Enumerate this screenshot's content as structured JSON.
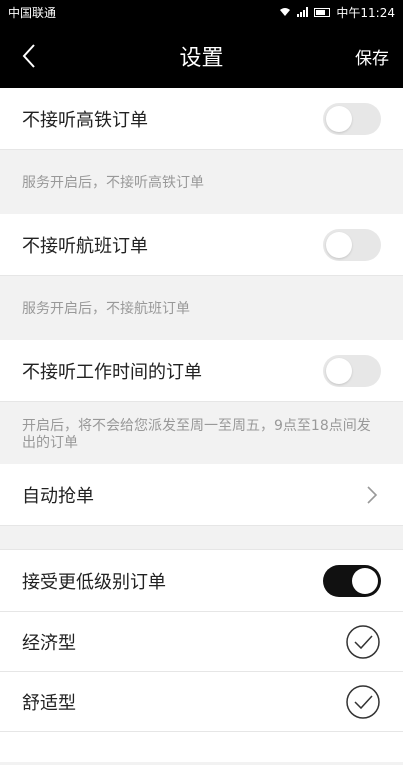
{
  "statusbar": {
    "carrier": "中国联通",
    "time": "中午11:24"
  },
  "navbar": {
    "title": "设置",
    "save": "保存"
  },
  "settings": {
    "high_speed_rail": {
      "label": "不接听高铁订单",
      "on": false,
      "hint": "服务开启后，不接听高铁订单"
    },
    "flight": {
      "label": "不接听航班订单",
      "on": false,
      "hint": "服务开启后，不接航班订单"
    },
    "work_hours": {
      "label": "不接听工作时间的订单",
      "on": false,
      "hint": "开启后，将不会给您派发至周一至周五，9点至18点间发出的订单"
    },
    "auto_grab": {
      "label": "自动抢单"
    },
    "lower_level": {
      "label": "接受更低级别订单",
      "on": true
    },
    "economy": {
      "label": "经济型",
      "checked": true
    },
    "comfort": {
      "label": "舒适型",
      "checked": true
    }
  },
  "colors": {
    "header": "#000000",
    "toggle_on": "#111111",
    "toggle_off": "#e7e7e7",
    "hint_text": "#999999"
  }
}
